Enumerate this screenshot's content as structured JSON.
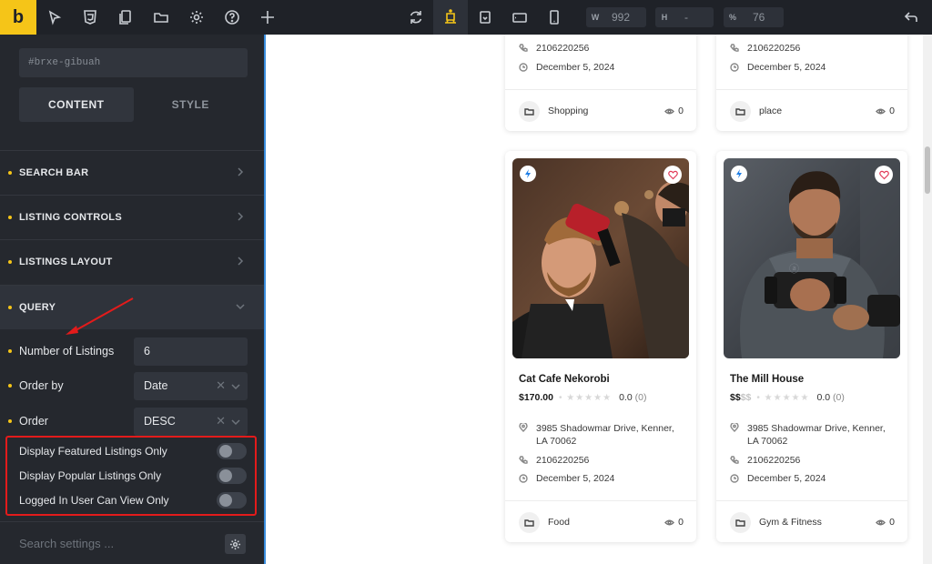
{
  "toolbar": {
    "logo": "b",
    "width_label": "W",
    "width_value": "992",
    "height_label": "H",
    "height_value": "-",
    "percent_label": "%",
    "percent_value": "76"
  },
  "sidebar": {
    "element_id": "#brxe-gibuah",
    "tabs": [
      "CONTENT",
      "STYLE"
    ],
    "sections": [
      "SEARCH BAR",
      "LISTING CONTROLS",
      "LISTINGS LAYOUT",
      "QUERY"
    ],
    "controls": {
      "num_listings_label": "Number of Listings",
      "num_listings_value": "6",
      "order_by_label": "Order by",
      "order_by_value": "Date",
      "order_label": "Order",
      "order_value": "DESC"
    },
    "toggles": [
      {
        "label": "Display Featured Listings Only",
        "on": false
      },
      {
        "label": "Display Popular Listings Only",
        "on": false
      },
      {
        "label": "Logged In User Can View Only",
        "on": false
      }
    ],
    "search_placeholder": "Search settings ..."
  },
  "cards_top": [
    {
      "phone": "2106220256",
      "date": "December 5, 2024",
      "category": "Shopping",
      "views": "0"
    },
    {
      "phone": "2106220256",
      "date": "December 5, 2024",
      "category": "place",
      "views": "0"
    }
  ],
  "cards": [
    {
      "title": "Cat Cafe Nekorobi",
      "price": "$170.00",
      "price_faded": "",
      "rating": "0.0",
      "rating_count": "(0)",
      "address": "3985 Shadowmar Drive, Kenner, LA 70062",
      "phone": "2106220256",
      "date": "December 5, 2024",
      "category": "Food",
      "views": "0"
    },
    {
      "title": "The Mill House",
      "price": "$$",
      "price_faded": "$$",
      "rating": "0.0",
      "rating_count": "(0)",
      "address": "3985 Shadowmar Drive, Kenner, LA 70062",
      "phone": "2106220256",
      "date": "December 5, 2024",
      "category": "Gym & Fitness",
      "views": "0"
    }
  ],
  "colors": {
    "accent": "#f5c518",
    "highlight_border": "#e31b1b",
    "sidebar_bg": "#25282e",
    "toolbar_bg": "#1f2228"
  }
}
